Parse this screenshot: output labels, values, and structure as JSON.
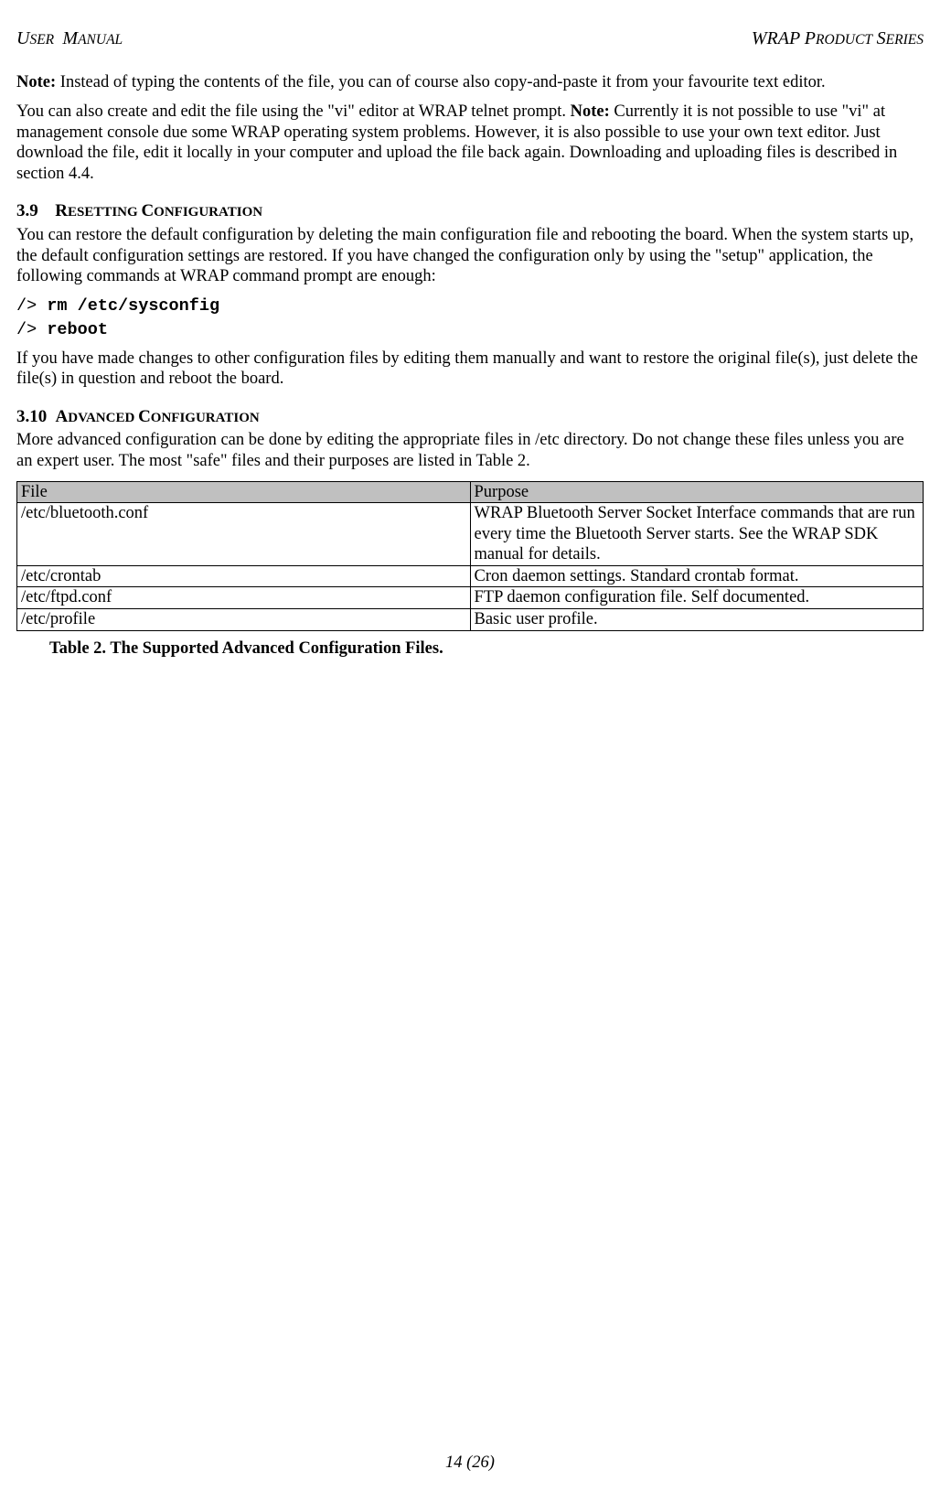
{
  "header": {
    "left_first": "U",
    "left_rest": "SER",
    "left2_first": "M",
    "left2_rest": "ANUAL",
    "right_first": "WRAP P",
    "right_rest": "RODUCT",
    "right2_first": "S",
    "right2_rest": "ERIES"
  },
  "p1": {
    "note": "Note:",
    "text": " Instead of typing the contents of the file, you can of course also copy-and-paste it from your favourite text editor."
  },
  "p2": {
    "a": "You can also create and edit the file using the \"vi\" editor at WRAP telnet prompt. ",
    "note": "Note:",
    "b": " Currently it is not possible to use \"vi\" at management console due some WRAP operating system problems. However, it is also possible to use your own text editor. Just download the file, edit it locally in your computer and upload the file back again. Downloading and uploading files is described in section 4.4."
  },
  "sec39": {
    "num": "3.9",
    "t1_first": "R",
    "t1_rest": "ESETTING ",
    "t2_first": "C",
    "t2_rest": "ONFIGURATION"
  },
  "p3": "You can restore the default configuration by deleting the main configuration file and rebooting the board. When the system starts up, the default configuration settings are restored. If you have changed the configuration only by using the \"setup\" application, the following commands at WRAP command prompt are enough:",
  "cmd1": {
    "prompt": "/> ",
    "cmd": "rm /etc/sysconfig"
  },
  "cmd2": {
    "prompt": "/> ",
    "cmd": "reboot"
  },
  "p4": "If you have made changes to other configuration files by editing them manually and want to restore the original file(s), just delete the file(s) in question and reboot the board.",
  "sec310": {
    "num": "3.10",
    "t1_first": "A",
    "t1_rest": "DVANCED ",
    "t2_first": "C",
    "t2_rest": "ONFIGURATION"
  },
  "p5": "More advanced configuration can be done by editing the appropriate files in /etc directory. Do not change these files unless you are an expert user. The most \"safe\" files and their purposes are listed in Table 2.",
  "table": {
    "h1": "File",
    "h2": "Purpose",
    "rows": [
      {
        "file": "/etc/bluetooth.conf",
        "purpose": "WRAP Bluetooth Server Socket Interface commands that are run every time the Bluetooth Server starts. See the WRAP SDK manual for details."
      },
      {
        "file": "/etc/crontab",
        "purpose": "Cron daemon settings. Standard crontab format."
      },
      {
        "file": "/etc/ftpd.conf",
        "purpose": "FTP daemon configuration file. Self documented."
      },
      {
        "file": "/etc/profile",
        "purpose": "Basic user profile."
      }
    ]
  },
  "caption": "Table 2. The Supported Advanced Configuration Files.",
  "footer": "14 (26)"
}
